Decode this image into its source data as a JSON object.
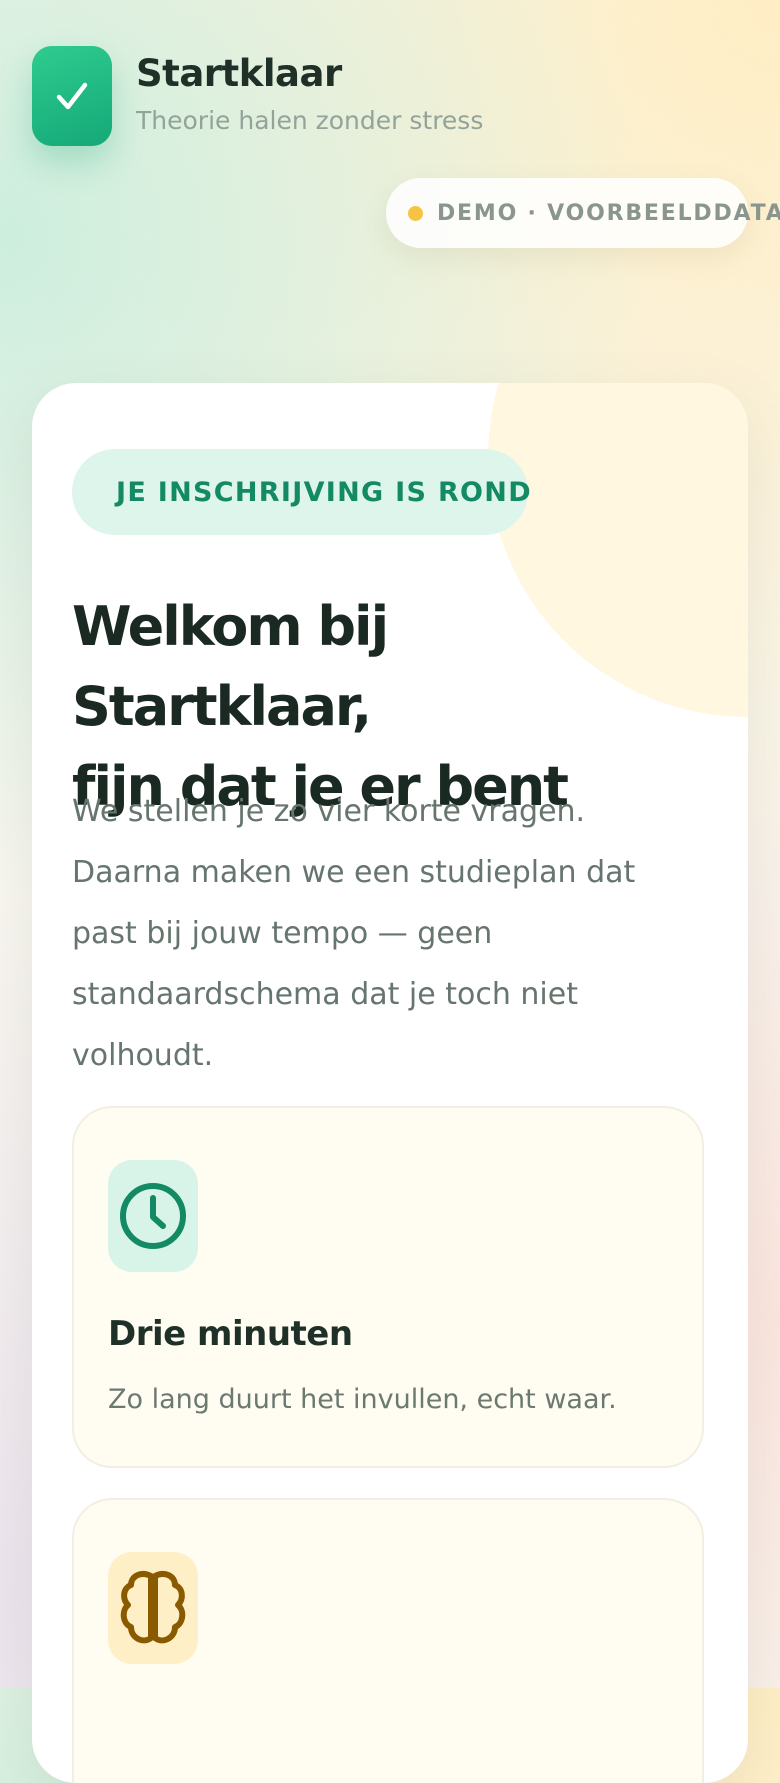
{
  "brand": {
    "name": "Startklaar",
    "tagline": "Theorie halen zonder stress",
    "logo_icon": "check-icon",
    "color": "#1fb280"
  },
  "demo_badge": {
    "label": "DEMO · VOORBEELDDATA",
    "dot_color": "#f6c443"
  },
  "welcome": {
    "status_badge": "JE INSCHRIJVING IS ROND",
    "status_icon": "check-icon",
    "headline_line1": "Welkom bij Startklaar,",
    "headline_line2": "fijn dat je er bent",
    "intro": "We stellen je zo vier korte vragen. Daarna maken we een studieplan dat past bij jouw tempo — geen standaardschema dat je toch niet volhoudt."
  },
  "features": [
    {
      "icon": "clock-icon",
      "title": "Drie minuten",
      "description": "Zo lang duurt het invullen, echt waar.",
      "accent": "#138a64"
    },
    {
      "icon": "brain-icon",
      "title": "",
      "description": "",
      "accent": "#8a5a00"
    }
  ]
}
